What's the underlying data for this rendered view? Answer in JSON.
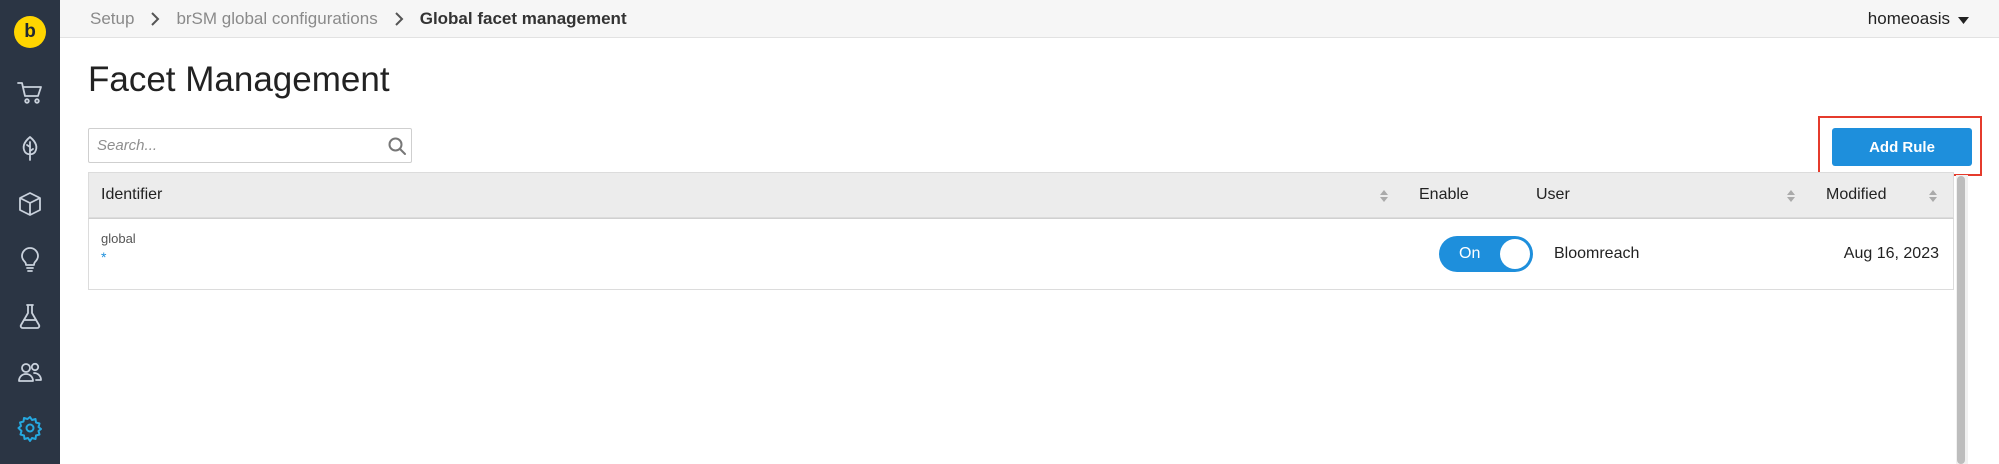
{
  "sidebar": {
    "logo_letter": "b",
    "items": [
      {
        "name": "cart-icon"
      },
      {
        "name": "leaf-icon"
      },
      {
        "name": "cube-icon"
      },
      {
        "name": "lightbulb-icon"
      },
      {
        "name": "flask-icon"
      },
      {
        "name": "users-icon"
      },
      {
        "name": "gear-icon",
        "active": true
      }
    ]
  },
  "breadcrumb": {
    "items": [
      "Setup",
      "brSM global configurations",
      "Global facet management"
    ]
  },
  "account": {
    "name": "homeoasis"
  },
  "page": {
    "title": "Facet Management"
  },
  "search": {
    "placeholder": "Search...",
    "value": ""
  },
  "toolbar": {
    "add_rule_label": "Add Rule"
  },
  "table": {
    "columns": [
      "Identifier",
      "Enable",
      "User",
      "Modified"
    ],
    "rows": [
      {
        "identifier": "global",
        "marker": "*",
        "enable_label": "On",
        "enabled": true,
        "user": "Bloomreach",
        "modified": "Aug 16, 2023"
      }
    ]
  },
  "colors": {
    "sidebar_bg": "#2b3544",
    "accent": "#1e8fdc",
    "logo": "#ffd500",
    "highlight": "#e53b2c"
  }
}
